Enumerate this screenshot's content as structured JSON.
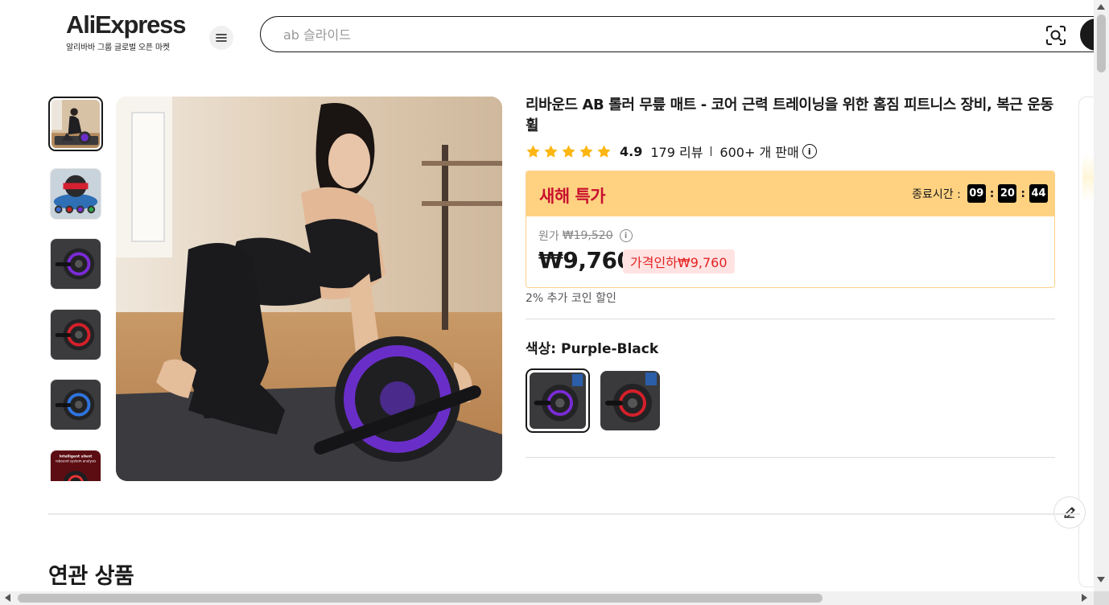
{
  "header": {
    "brand": "AliExpress",
    "tagline": "알리바바 그룹 글로벌 오픈 마켓",
    "menu_icon": "hamburger-icon",
    "search": {
      "placeholder": "ab 슬라이드",
      "value": "",
      "image_search_icon": "camera-scan-icon",
      "submit_icon": "search-icon"
    }
  },
  "product": {
    "title": "리바운드 AB 롤러 무릎 매트 - 코어 근력 트레이닝을 위한 홈짐 피트니스 장비, 복근 운동 휠",
    "rating": 4.9,
    "star_count": 5,
    "reviews": "179 리뷰",
    "sold": "600+ 개 판매",
    "info_icon": "info-icon",
    "thumbnails": [
      {
        "name": "woman-ab-roller",
        "selected": true
      },
      {
        "name": "roller-variants"
      },
      {
        "name": "purple-roller"
      },
      {
        "name": "red-roller"
      },
      {
        "name": "blue-roller"
      },
      {
        "name": "rebound-system"
      }
    ],
    "thumb_overlay_text": "Intelligent silent rebound system analysis"
  },
  "deal": {
    "title": "새해 특가",
    "countdown_label": "종료시간 :",
    "hours": "09",
    "minutes": "20",
    "seconds": "44",
    "original_label": "원가",
    "original_price": "₩19,520",
    "price": "₩9,760",
    "discount": "가격인하₩9,760",
    "coin_note": "2% 추가 코인 할인"
  },
  "variant": {
    "label": "색상: Purple-Black",
    "options": [
      {
        "name": "Purple-Black",
        "selected": true,
        "accent": "#7a2bd6"
      },
      {
        "name": "Red-Black",
        "selected": false,
        "accent": "#d4202a"
      }
    ]
  },
  "related": {
    "heading": "연관 상품"
  },
  "colors": {
    "deal_header": "#ffd282",
    "deal_title": "#c8102e",
    "discount_bg": "#ffe3e3",
    "discount_text": "#e52222",
    "star": "#fdb613"
  }
}
